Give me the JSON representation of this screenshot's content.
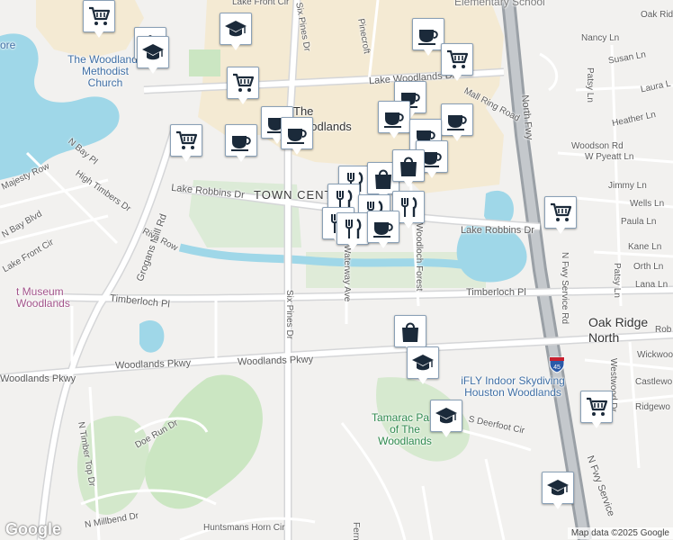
{
  "colors": {
    "water": "#9fd7e8",
    "land": "#f2f1ef",
    "park": "#cbe6c2",
    "commercial": "#f4ead3",
    "highway": "#9aa0a6",
    "road": "#ffffff",
    "marker_icon": "#1b2a3a"
  },
  "labels": {
    "elementary_school": "Elementary School",
    "lake_front_cir_top": "Lake Front Cir",
    "six_pines_dr_top": "Six Pines Dr",
    "oak_ridge_top": "Oak Ridg",
    "nancy_ln": "Nancy Ln",
    "susan_ln": "Susan Ln",
    "laura_ln": "Laura L",
    "heather_ln": "Heather Ln",
    "pinecroft": "Pinecroft",
    "lake_woodlands_dr": "Lake Woodlands Dr",
    "mall_ring_road": "Mall Ring Road",
    "woodlands_methodist": "The Woodlands Methodist Church",
    "ore": "ore",
    "the_woodlands": "The Woodlands",
    "town_center": "TOWN CENTER",
    "north_fwy": "North Fwy",
    "patsy_ln_top": "Patsy Ln",
    "woodson_rd": "Woodson Rd",
    "w_pyeatt_ln": "W Pyeatt Ln",
    "jimmy_ln": "Jimmy Ln",
    "wells_ln": "Wells Ln",
    "paula_ln": "Paula Ln",
    "kane_ln": "Kane Ln",
    "orth_ln": "Orth Ln",
    "lana_ln": "Lana Ln",
    "n_bay_pl": "N Bay Pl",
    "majesty_row": "Majesty Row",
    "high_timbers_dr": "High Timbers Dr",
    "n_bay_blvd": "N Bay Blvd",
    "lake_front_cir": "Lake Front Cir",
    "grogans_mill_rd": "Grogans Mill Rd",
    "lake_robbins_dr_w": "Lake Robbins Dr",
    "lake_robbins_dr_e": "Lake Robbins Dr",
    "riva_row": "Riva Row",
    "waterway_ave": "Waterway Ave",
    "woodloch_forest": "Woodloch Forest",
    "n_fwy_service_rd": "N Fwy Service Rd",
    "patsy_ln": "Patsy Ln",
    "museum": "t Museum Woodlands",
    "timberloch_pl_w": "Timberloch Pl",
    "six_pines_dr": "Six Pines Dr",
    "timberloch_pl_e": "Timberloch Pl",
    "oak_ridge_north": "Oak Ridge North",
    "rob": "Rob",
    "wickwood": "Wickwoo",
    "woodlands_pkwy_w": "Woodlands Pkwy",
    "woodlands_pkwy_e": "Woodlands Pkwy",
    "ifly": "iFLY Indoor Skydiving Houston Woodlands",
    "castlewood": "Castlewo",
    "westwood_dr": "Westwood Dr",
    "ridgewood": "Ridgewo",
    "doe_run_dr": "Doe Run Dr",
    "tamarac_park": "Tamarac Park of The Woodlands",
    "s_deerfoot_cir": "S Deerfoot Cir",
    "n_timber_top_dr": "N Timber Top Dr",
    "n_millbend_dr": "N Millbend Dr",
    "huntsmans_horn_cir": "Huntsmans Horn Cir",
    "fern": "Fern",
    "n_fwy_service_rd_bottom": "N Fwy Service",
    "interstate": "45",
    "google": "Google",
    "map_data": "Map data ©2025 Google"
  },
  "markers": [
    {
      "id": "m1",
      "icon": "shopping-cart-icon"
    },
    {
      "id": "m2",
      "icon": "school-icon"
    },
    {
      "id": "m3",
      "icon": "school-icon"
    },
    {
      "id": "m4",
      "icon": "school-icon"
    },
    {
      "id": "m5",
      "icon": "coffee-icon"
    },
    {
      "id": "m6",
      "icon": "shopping-cart-icon"
    },
    {
      "id": "m7",
      "icon": "coffee-icon"
    },
    {
      "id": "m8",
      "icon": "shopping-cart-icon"
    },
    {
      "id": "m9",
      "icon": "coffee-icon"
    },
    {
      "id": "m10",
      "icon": "coffee-icon"
    },
    {
      "id": "m11",
      "icon": "shopping-cart-icon"
    },
    {
      "id": "m12",
      "icon": "coffee-icon"
    },
    {
      "id": "m13",
      "icon": "coffee-icon"
    },
    {
      "id": "m14",
      "icon": "coffee-icon"
    },
    {
      "id": "m15",
      "icon": "coffee-icon"
    },
    {
      "id": "m16",
      "icon": "coffee-icon"
    },
    {
      "id": "m17",
      "icon": "restaurant-icon"
    },
    {
      "id": "m18",
      "icon": "shopping-bag-icon"
    },
    {
      "id": "m19",
      "icon": "shopping-bag-icon"
    },
    {
      "id": "m20",
      "icon": "restaurant-icon"
    },
    {
      "id": "m21",
      "icon": "restaurant-icon"
    },
    {
      "id": "m22",
      "icon": "restaurant-icon"
    },
    {
      "id": "m23",
      "icon": "restaurant-icon"
    },
    {
      "id": "m24",
      "icon": "restaurant-icon"
    },
    {
      "id": "m25",
      "icon": "coffee-icon"
    },
    {
      "id": "m26",
      "icon": "shopping-cart-icon"
    },
    {
      "id": "m27",
      "icon": "shopping-bag-icon"
    },
    {
      "id": "m28",
      "icon": "school-icon"
    },
    {
      "id": "m29",
      "icon": "school-icon"
    },
    {
      "id": "m30",
      "icon": "shopping-cart-icon"
    },
    {
      "id": "m31",
      "icon": "school-icon"
    }
  ]
}
